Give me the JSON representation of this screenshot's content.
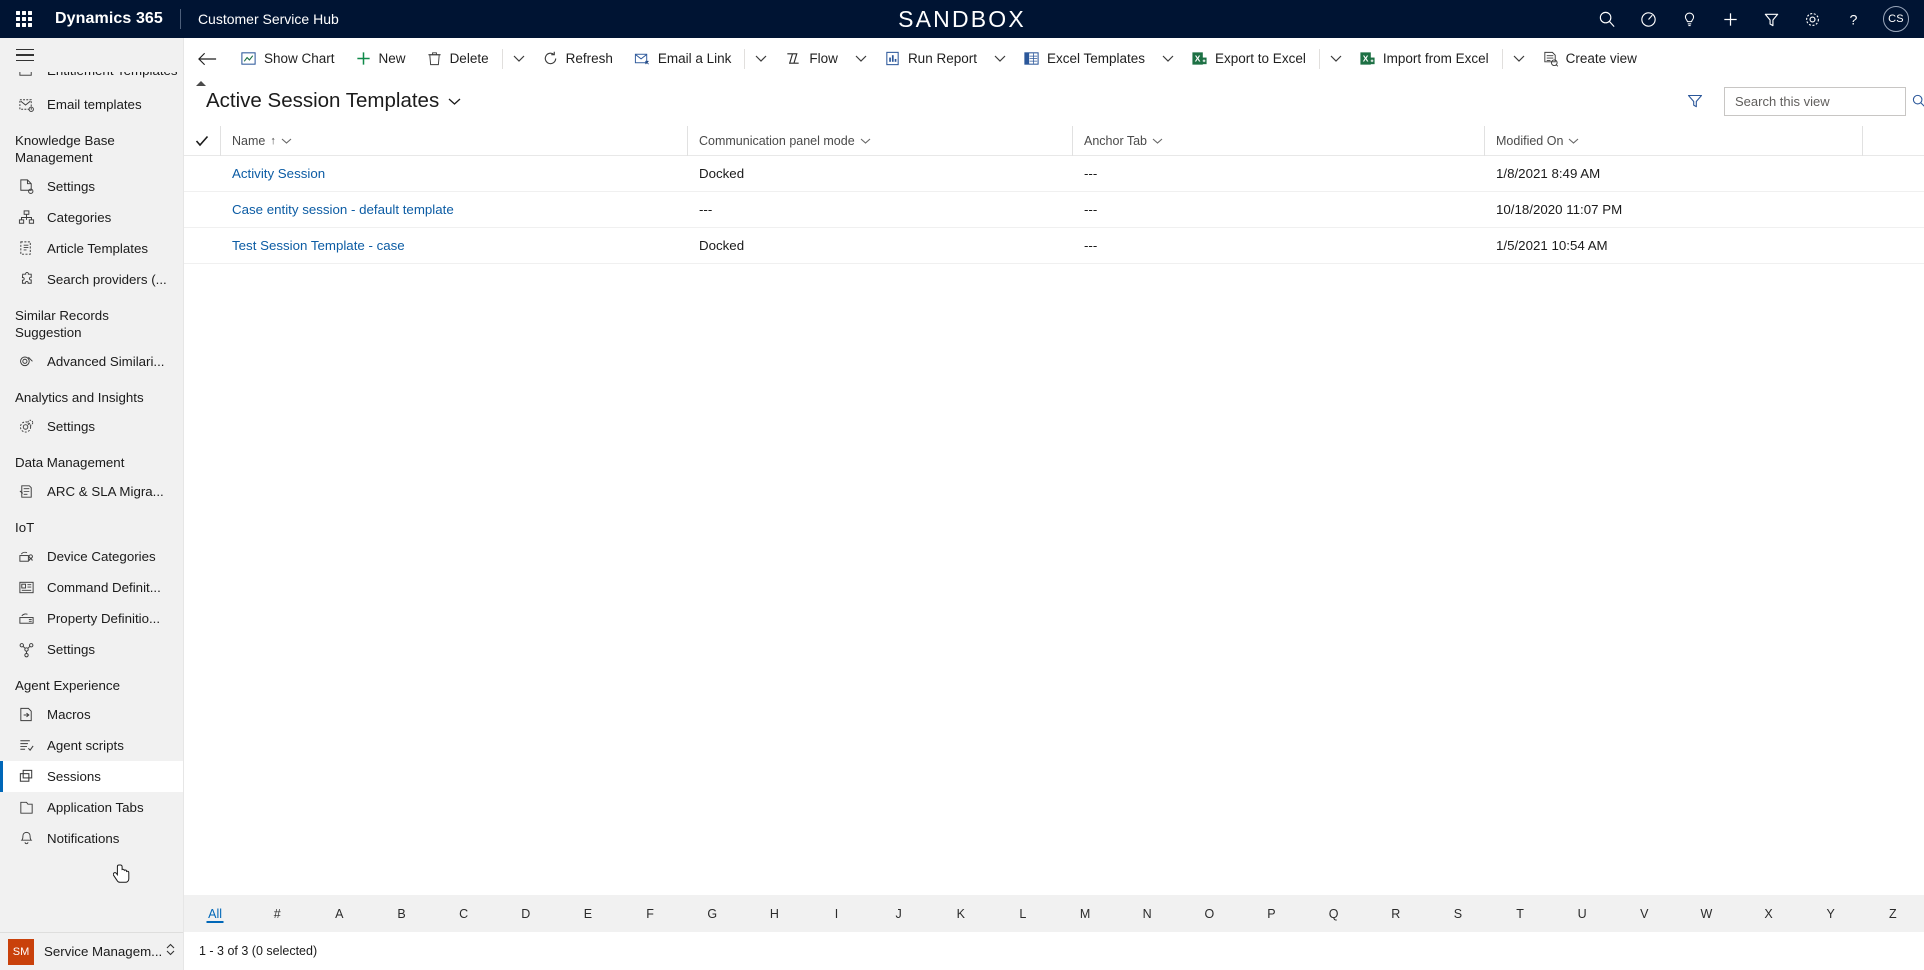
{
  "topbar": {
    "waffle_icon": "app-launcher-icon",
    "brand": "Dynamics 365",
    "app_name": "Customer Service Hub",
    "environment_banner": "SANDBOX",
    "icons": [
      {
        "name": "search-icon",
        "label": "Search"
      },
      {
        "name": "diagnostics-icon",
        "label": "Diagnostics"
      },
      {
        "name": "lightbulb-icon",
        "label": "Assistant"
      },
      {
        "name": "quick-create-icon",
        "label": "New"
      },
      {
        "name": "filter-icon",
        "label": "Filters"
      },
      {
        "name": "settings-gear-icon",
        "label": "Settings"
      },
      {
        "name": "help-icon",
        "label": "Help"
      }
    ],
    "avatar_initials": "CS"
  },
  "commandbar": {
    "back_label": "Back",
    "items": [
      {
        "name": "show-chart-button",
        "label": "Show Chart",
        "icon": "chart-icon",
        "caret": false
      },
      {
        "name": "new-button",
        "label": "New",
        "icon": "plus-icon",
        "caret": false
      },
      {
        "name": "delete-button",
        "label": "Delete",
        "icon": "trash-icon",
        "caret": false
      },
      {
        "name": "overflow-caret-1",
        "label": "",
        "icon": "",
        "caret": true
      },
      {
        "name": "refresh-button",
        "label": "Refresh",
        "icon": "refresh-icon",
        "caret": false
      },
      {
        "name": "email-a-link-button",
        "label": "Email a Link",
        "icon": "email-icon",
        "caret": false
      },
      {
        "name": "overflow-caret-2",
        "label": "",
        "icon": "",
        "caret": true
      },
      {
        "name": "flow-button",
        "label": "Flow",
        "icon": "flow-icon",
        "caret": true
      },
      {
        "name": "run-report-button",
        "label": "Run Report",
        "icon": "report-icon",
        "caret": true
      },
      {
        "name": "excel-templates-button",
        "label": "Excel Templates",
        "icon": "excel-template-icon",
        "caret": true
      },
      {
        "name": "export-to-excel-button",
        "label": "Export to Excel",
        "icon": "excel-icon",
        "caret": false
      },
      {
        "name": "overflow-caret-3",
        "label": "",
        "icon": "",
        "caret": true
      },
      {
        "name": "import-from-excel-button",
        "label": "Import from Excel",
        "icon": "excel-icon",
        "caret": false
      },
      {
        "name": "overflow-caret-4",
        "label": "",
        "icon": "",
        "caret": true
      },
      {
        "name": "create-view-button",
        "label": "Create view",
        "icon": "create-view-icon",
        "caret": false
      }
    ]
  },
  "sidebar": {
    "hamburger_label": "Site Map",
    "clipped_top_item": {
      "label": "Entitlement Templates",
      "icon": "template-icon"
    },
    "sections": [
      {
        "group": null,
        "items": [
          {
            "name": "sidebar-item-email-templates",
            "label": "Email templates",
            "icon": "email-template-icon",
            "selected": false
          }
        ]
      },
      {
        "group": "Knowledge Base Management",
        "items": [
          {
            "name": "sidebar-item-kb-settings",
            "label": "Settings",
            "icon": "document-settings-icon",
            "selected": false
          },
          {
            "name": "sidebar-item-categories",
            "label": "Categories",
            "icon": "hierarchy-icon",
            "selected": false
          },
          {
            "name": "sidebar-item-article-templates",
            "label": "Article Templates",
            "icon": "article-icon",
            "selected": false
          },
          {
            "name": "sidebar-item-search-providers",
            "label": "Search providers (...",
            "icon": "puzzle-icon",
            "selected": false
          }
        ]
      },
      {
        "group": "Similar Records Suggestion",
        "items": [
          {
            "name": "sidebar-item-advanced-similarity",
            "label": "Advanced Similari...",
            "icon": "similarity-icon",
            "selected": false
          }
        ]
      },
      {
        "group": "Analytics and Insights",
        "items": [
          {
            "name": "sidebar-item-analytics-settings",
            "label": "Settings",
            "icon": "gear-icon",
            "selected": false
          }
        ]
      },
      {
        "group": "Data Management",
        "items": [
          {
            "name": "sidebar-item-arc-sla-migration",
            "label": "ARC & SLA Migra...",
            "icon": "migration-icon",
            "selected": false
          }
        ]
      },
      {
        "group": "IoT",
        "items": [
          {
            "name": "sidebar-item-device-categories",
            "label": "Device Categories",
            "icon": "device-icon",
            "selected": false
          },
          {
            "name": "sidebar-item-command-definitions",
            "label": "Command Definit...",
            "icon": "command-icon",
            "selected": false
          },
          {
            "name": "sidebar-item-property-definitions",
            "label": "Property Definitio...",
            "icon": "property-icon",
            "selected": false
          },
          {
            "name": "sidebar-item-iot-settings",
            "label": "Settings",
            "icon": "nodes-icon",
            "selected": false
          }
        ]
      },
      {
        "group": "Agent Experience",
        "items": [
          {
            "name": "sidebar-item-macros",
            "label": "Macros",
            "icon": "macro-icon",
            "selected": false
          },
          {
            "name": "sidebar-item-agent-scripts",
            "label": "Agent scripts",
            "icon": "script-icon",
            "selected": false
          },
          {
            "name": "sidebar-item-sessions",
            "label": "Sessions",
            "icon": "sessions-icon",
            "selected": true
          },
          {
            "name": "sidebar-item-application-tabs",
            "label": "Application Tabs",
            "icon": "tab-icon",
            "selected": false
          },
          {
            "name": "sidebar-item-notifications",
            "label": "Notifications",
            "icon": "bell-icon",
            "selected": false
          }
        ]
      }
    ],
    "footer": {
      "badge": "SM",
      "label": "Service Managem...",
      "chevron": "updown-chevron-icon"
    }
  },
  "view": {
    "title": "Active Session Templates",
    "title_caret": "chevron-down-icon",
    "filter_icon": "filter-icon",
    "search_placeholder": "Search this view",
    "search_value": "",
    "search_icon": "search-icon"
  },
  "grid": {
    "columns": [
      {
        "name": "column-name",
        "label": "Name",
        "sorted": true,
        "sort_arrow": "↑"
      },
      {
        "name": "column-communication-panel-mode",
        "label": "Communication panel mode",
        "sorted": false,
        "sort_arrow": ""
      },
      {
        "name": "column-anchor-tab",
        "label": "Anchor Tab",
        "sorted": false,
        "sort_arrow": ""
      },
      {
        "name": "column-modified-on",
        "label": "Modified On",
        "sorted": false,
        "sort_arrow": ""
      }
    ],
    "rows": [
      {
        "name": "Activity Session",
        "panel_mode": "Docked",
        "anchor_tab": "---",
        "modified_on": "1/8/2021 8:49 AM"
      },
      {
        "name": "Case entity session - default template",
        "panel_mode": "---",
        "anchor_tab": "---",
        "modified_on": "10/18/2020 11:07 PM"
      },
      {
        "name": "Test Session Template - case",
        "panel_mode": "Docked",
        "anchor_tab": "---",
        "modified_on": "1/5/2021 10:54 AM"
      }
    ]
  },
  "footer": {
    "alphabet": [
      "All",
      "#",
      "A",
      "B",
      "C",
      "D",
      "E",
      "F",
      "G",
      "H",
      "I",
      "J",
      "K",
      "L",
      "M",
      "N",
      "O",
      "P",
      "Q",
      "R",
      "S",
      "T",
      "U",
      "V",
      "W",
      "X",
      "Y",
      "Z"
    ],
    "active_letter": "All",
    "status": "1 - 3 of 3 (0 selected)"
  },
  "colors": {
    "nav_bg": "#001433",
    "accent": "#0067b8",
    "link": "#0c5ca4",
    "sidebar_bg": "#f1f1f1",
    "excel_green": "#1d7044",
    "badge_orange": "#c9410b"
  }
}
